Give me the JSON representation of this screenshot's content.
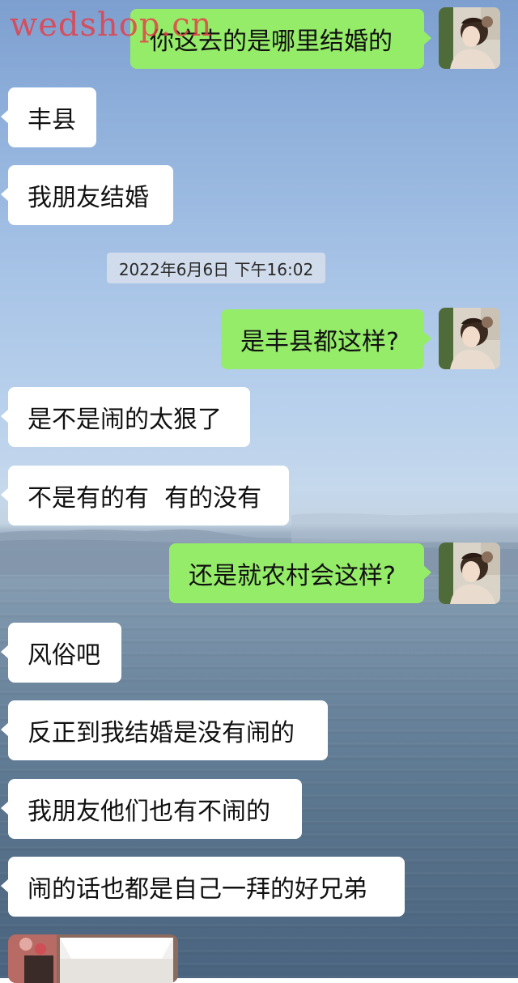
{
  "watermark": "wedshop.cn",
  "timestamp": "2022年6月6日 下午16:02",
  "messages": [
    {
      "side": "right",
      "text": "你这去的是哪里结婚的"
    },
    {
      "side": "left",
      "text": "丰县"
    },
    {
      "side": "left",
      "text": "我朋友结婚"
    },
    {
      "side": "right",
      "text": "是丰县都这样?"
    },
    {
      "side": "left",
      "text": "是不是闹的太狠了"
    },
    {
      "side": "left",
      "text": "不是有的有  有的没有"
    },
    {
      "side": "right",
      "text": "还是就农村会这样?"
    },
    {
      "side": "left",
      "text": "风俗吧"
    },
    {
      "side": "left",
      "text": "反正到我结婚是没有闹的"
    },
    {
      "side": "left",
      "text": "我朋友他们也有不闹的"
    },
    {
      "side": "left",
      "text": "闹的话也都是自己一拜的好兄弟"
    }
  ],
  "colors": {
    "outgoing_bubble": "#95ec69",
    "incoming_bubble": "#ffffff",
    "watermark": "#e63c46"
  },
  "icons": {
    "avatar": "user-avatar-photo",
    "image_message": "photo-thumbnail"
  }
}
